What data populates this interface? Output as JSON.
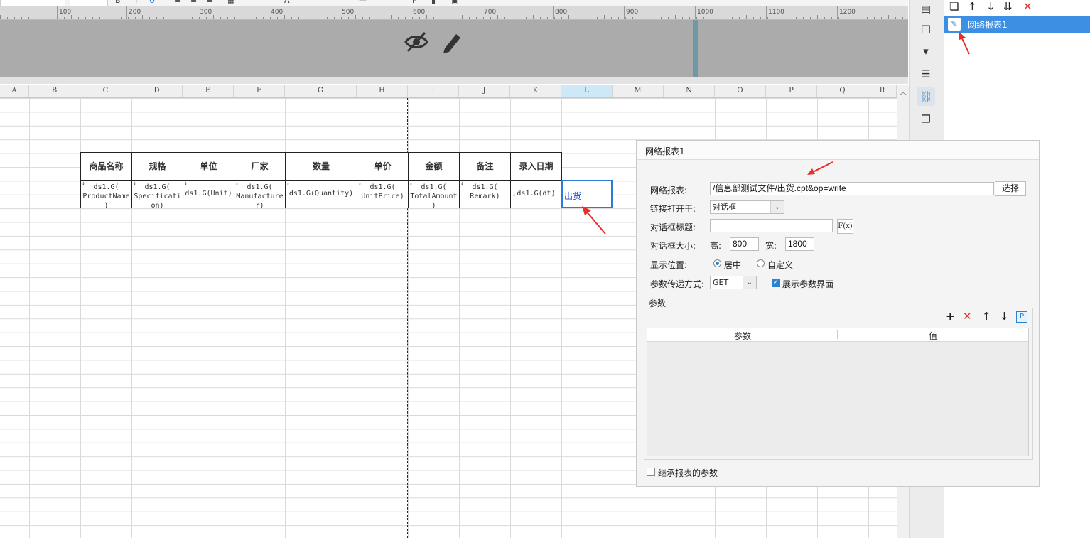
{
  "ruler": {
    "labels": [
      "100",
      "200",
      "300",
      "400",
      "500",
      "600",
      "700",
      "800",
      "900",
      "1000",
      "1100",
      "1200"
    ]
  },
  "sheet": {
    "columns": [
      "A",
      "B",
      "C",
      "D",
      "E",
      "F",
      "G",
      "H",
      "I",
      "J",
      "K",
      "L",
      "M",
      "N",
      "O",
      "P",
      "Q",
      "R"
    ],
    "selected_column": "L",
    "headers": [
      "商品名称",
      "规格",
      "单位",
      "厂家",
      "数量",
      "单价",
      "金额",
      "备注",
      "录入日期"
    ],
    "data": [
      [
        "ds1.G(",
        "ProductName",
        ")"
      ],
      [
        "ds1.G(",
        "Specificati",
        "on)"
      ],
      [
        "ds1.G(Unit)"
      ],
      [
        "ds1.G(",
        "Manufacture",
        "r)"
      ],
      [
        "ds1.G(Quantity)"
      ],
      [
        "ds1.G(",
        "UnitPrice)"
      ],
      [
        "ds1.G(",
        "TotalAmount",
        ")"
      ],
      [
        "ds1.G(",
        "Remark)"
      ],
      [
        "ds1.G(dt)"
      ]
    ],
    "link_text": "出货"
  },
  "right_panel": {
    "item_label": "网络报表1"
  },
  "dialog": {
    "title": "网络报表1",
    "report_label": "网络报表:",
    "report_value": "/信息部测试文件/出货.cpt&op=write",
    "choose_button": "选择",
    "open_in_label": "链接打开于:",
    "open_in_value": "对话框",
    "dialog_title_label": "对话框标题:",
    "dialog_title_value": "",
    "fx_button": "F(x)",
    "size_label": "对话框大小:",
    "height_label": "高:",
    "height_value": "800",
    "width_label": "宽:",
    "width_value": "1800",
    "position_label": "显示位置:",
    "position_options": [
      "居中",
      "自定义"
    ],
    "param_method_label": "参数传递方式:",
    "param_method_value": "GET",
    "show_param_label": "展示参数界面",
    "params_group_label": "参数",
    "params_columns": [
      "参数",
      "值"
    ],
    "inherit_label": "继承报表的参数"
  },
  "colors": {
    "accent": "#3c8fe3",
    "link": "#1a44d6",
    "arrow": "#e8302a",
    "band": "#ababab"
  }
}
